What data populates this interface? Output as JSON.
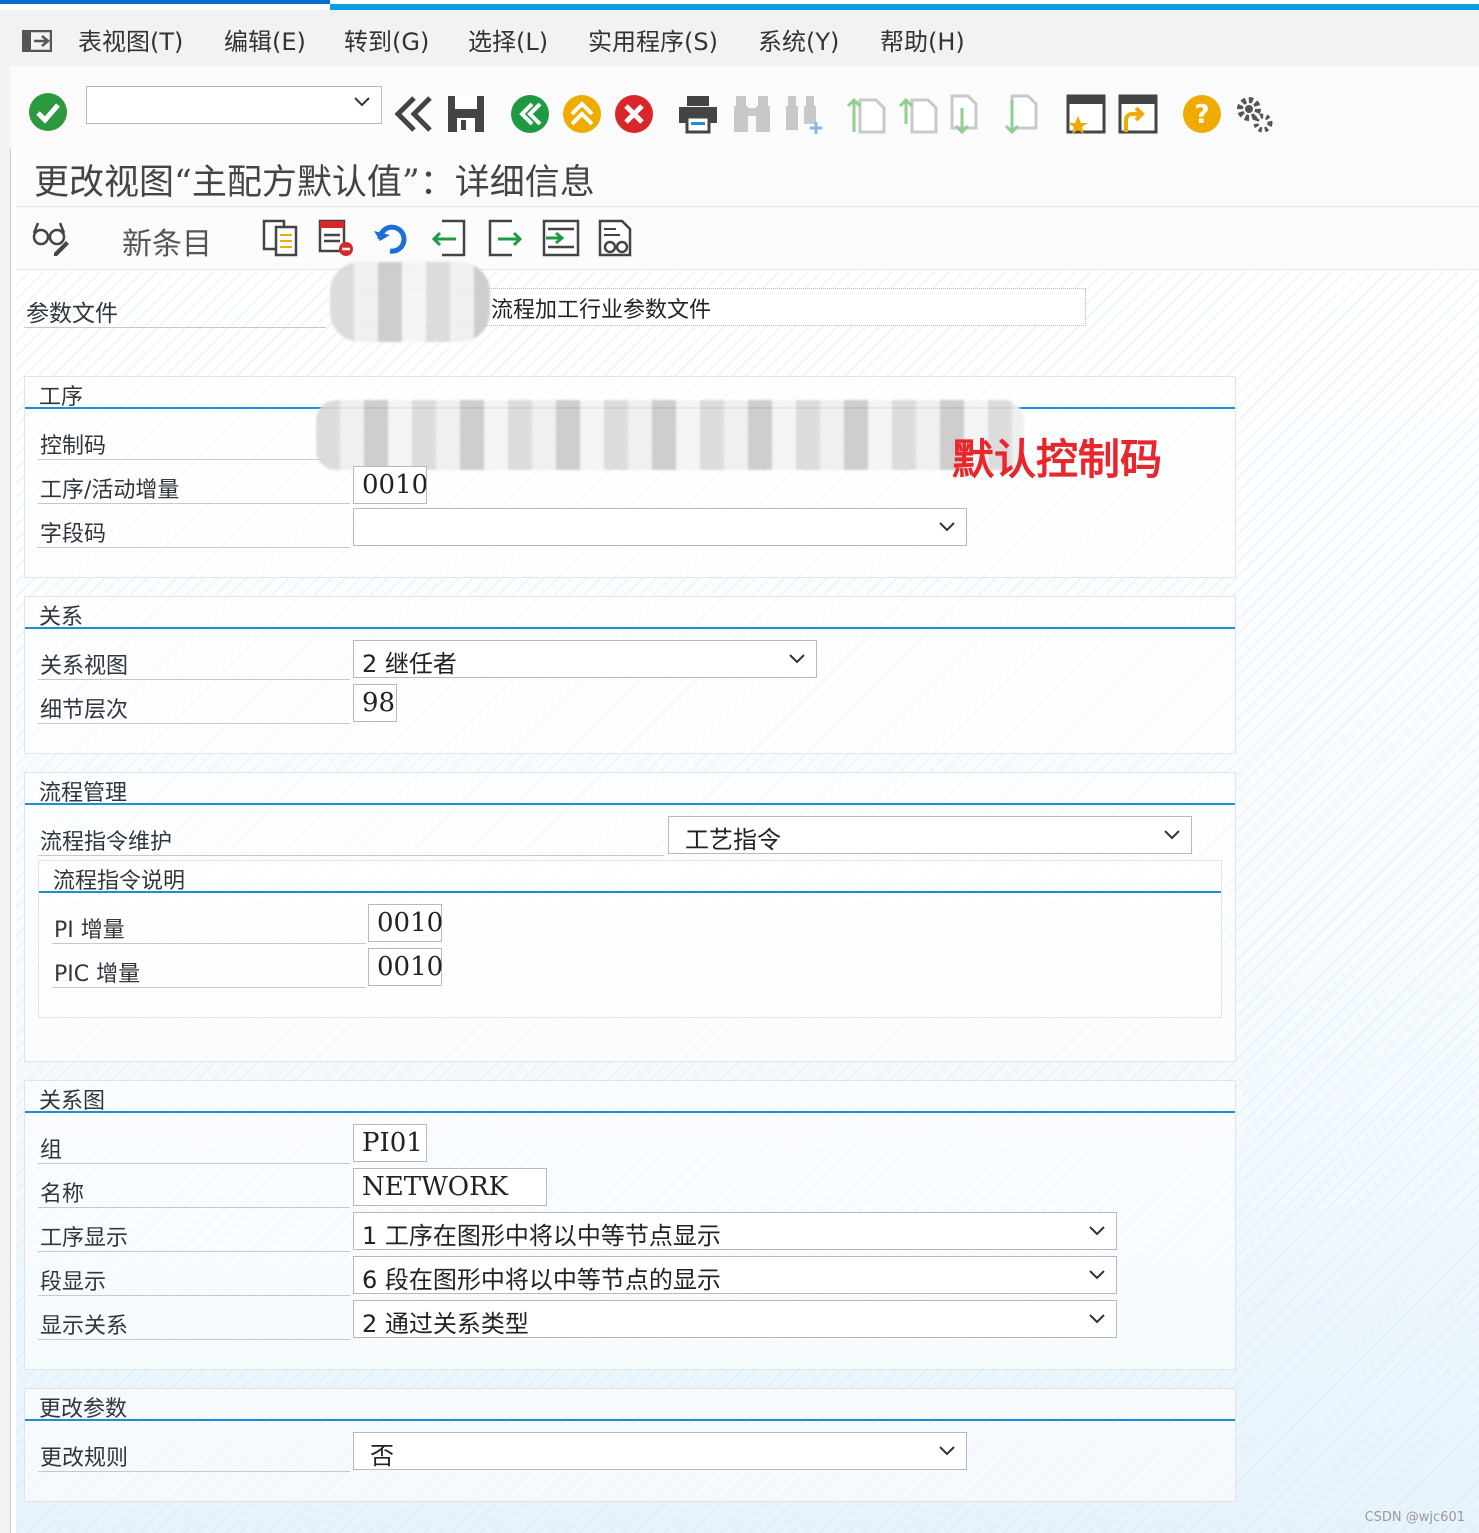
{
  "menubar": {
    "items": [
      "表视图(T)",
      "编辑(E)",
      "转到(G)",
      "选择(L)",
      "实用程序(S)",
      "系统(Y)",
      "帮助(H)"
    ]
  },
  "toolbar": {
    "command_value": "",
    "icons": [
      "enter-icon",
      "back-icon",
      "save-icon",
      "back-green-icon",
      "exit-icon",
      "cancel-icon",
      "print-icon",
      "find-icon",
      "find-next-icon",
      "first-page-icon",
      "previous-page-icon",
      "next-page-icon",
      "last-page-icon",
      "create-session-icon",
      "shortcut-icon",
      "help-icon",
      "settings-icon"
    ]
  },
  "title": "更改视图“主配方默认值”：详细信息",
  "app_toolbar": {
    "new_entry": "新条目",
    "icons": [
      "display-change-icon",
      "copy-icon",
      "delete-icon",
      "undo-icon",
      "previous-entry-icon",
      "next-entry-icon",
      "select-icon",
      "print-view-icon"
    ]
  },
  "profile": {
    "label": "参数文件",
    "value_visible": "流程加工行业参数文件"
  },
  "annotation": "默认控制码",
  "sections": {
    "operation": {
      "title": "工序",
      "control_key_label": "控制码",
      "increment_label": "工序/活动增量",
      "increment_value": "0010",
      "field_key_label": "字段码",
      "field_key_value": ""
    },
    "relationship": {
      "title": "关系",
      "view_label": "关系视图",
      "view_value": "2 继任者",
      "detail_label": "细节层次",
      "detail_value": "98"
    },
    "process_mgmt": {
      "title": "流程管理",
      "maint_label": "流程指令维护",
      "maint_value": "工艺指令",
      "desc_title": "流程指令说明",
      "pi_label": "PI 增量",
      "pi_value": "0010",
      "pic_label": "PIC 增量",
      "pic_value": "0010"
    },
    "graphic": {
      "title": "关系图",
      "group_label": "组",
      "group_value": "PI01",
      "name_label": "名称",
      "name_value": "NETWORK",
      "op_disp_label": "工序显示",
      "op_disp_value": "1 工序在图形中将以中等节点显示",
      "seg_disp_label": "段显示",
      "seg_disp_value": "6 段在图形中将以中等节点的显示",
      "rel_disp_label": "显示关系",
      "rel_disp_value": "2 通过关系类型"
    },
    "change": {
      "title": "更改参数",
      "rule_label": "更改规则",
      "rule_value": "否"
    }
  },
  "watermark": "CSDN @wjc601"
}
